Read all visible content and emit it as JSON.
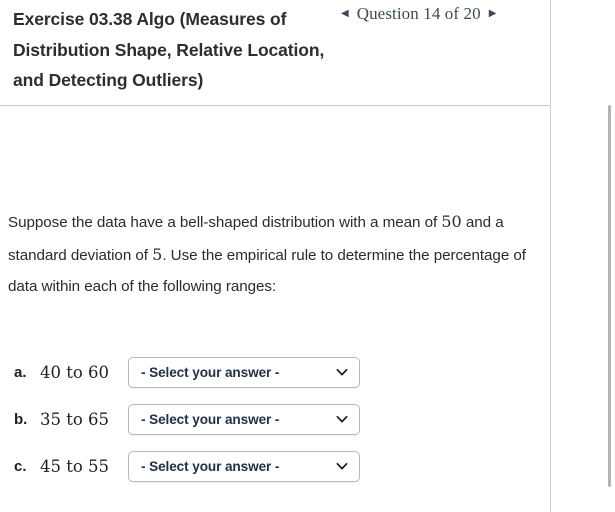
{
  "header": {
    "exercise_title": "Exercise 03.38 Algo (Measures of Distribution Shape, Relative Location, and Detecting Outliers)",
    "prev_arrow": "◀",
    "next_arrow": "▶",
    "question_label": "Question 14 of 20"
  },
  "question": {
    "prompt_part1": "Suppose the data have a bell-shaped distribution with a mean of ",
    "mean_value": "50",
    "prompt_part2": " and a standard deviation of ",
    "sd_value": "5",
    "prompt_part3": ". Use the empirical rule to determine the percentage of data within each of the following ranges:"
  },
  "answers": [
    {
      "letter": "a.",
      "range": "40 to 60",
      "selected": "- Select your answer -"
    },
    {
      "letter": "b.",
      "range": "35 to 65",
      "selected": "- Select your answer -"
    },
    {
      "letter": "c.",
      "range": "45 to 55",
      "selected": "- Select your answer -"
    }
  ],
  "colors": {
    "title": "#2e2e2e",
    "nav": "#3b4a5a",
    "select_text": "#23304a",
    "border": "#b9b9b9",
    "divider": "#cfcfcf",
    "scrollbar": "#b5b5b5"
  }
}
